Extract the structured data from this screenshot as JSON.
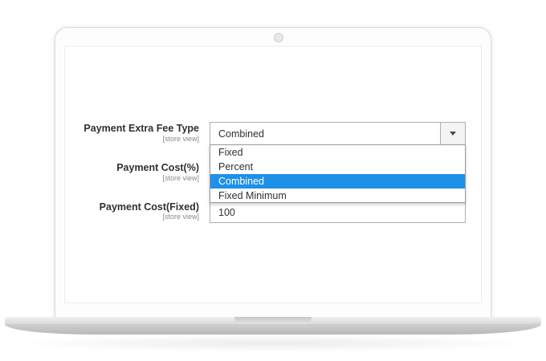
{
  "form": {
    "fields": [
      {
        "label": "Payment Extra Fee Type",
        "scope": "[store view]"
      },
      {
        "label": "Payment Cost(%)",
        "scope": "[store view]"
      },
      {
        "label": "Payment Cost(Fixed)",
        "scope": "[store view]"
      }
    ],
    "fee_type_select": {
      "value": "Combined",
      "options": [
        "Fixed",
        "Percent",
        "Combined",
        "Fixed Minimum"
      ],
      "selected_index": 2
    },
    "cost_fixed_input": {
      "value": "100"
    }
  },
  "colors": {
    "selected_option_bg": "#1e90e8",
    "label_text": "#303030",
    "scope_text": "#8a8a8a"
  }
}
